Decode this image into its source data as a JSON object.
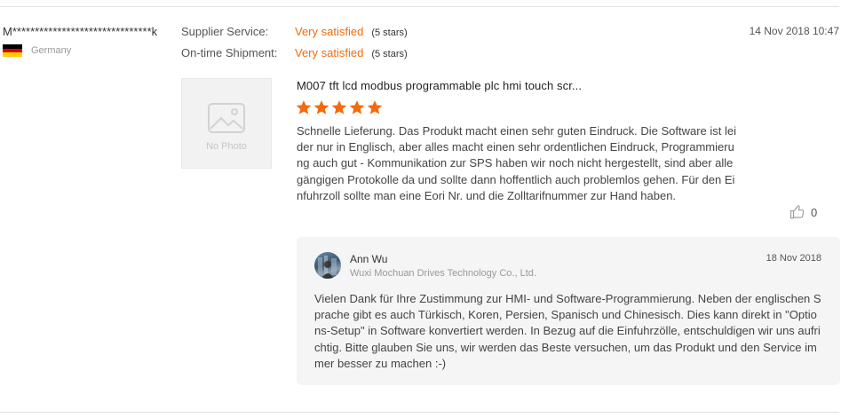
{
  "buyer": {
    "name": "M*******************************k",
    "country": "Germany",
    "flag_colors": [
      "#000000",
      "#dd0000",
      "#ffce00"
    ]
  },
  "ratings": [
    {
      "label": "Supplier Service:",
      "value": "Very satisfied",
      "stars": "(5 stars)"
    },
    {
      "label": "On-time Shipment:",
      "value": "Very satisfied",
      "stars": "(5 stars)"
    }
  ],
  "review": {
    "date": "14 Nov 2018 10:47",
    "no_photo_label": "No Photo",
    "product_title": "M007 tft lcd modbus programmable plc hmi touch scr...",
    "star_rating": 5,
    "text": "Schnelle Lieferung. Das Produkt macht einen sehr guten Eindruck. Die Software ist leider nur in Englisch, aber alles macht einen sehr ordentlichen Eindruck,  Programmierung auch gut - Kommunikation zur SPS haben wir noch nicht hergestellt, sind aber alle gängigen Protokolle da und sollte dann hoffentlich auch problemlos gehen. Für den Einfuhrzoll sollte man eine Eori Nr. und die Zolltarifnummer zur Hand haben.",
    "likes": "0"
  },
  "reply": {
    "name": "Ann Wu",
    "company": "Wuxi Mochuan Drives Technology Co., Ltd.",
    "date": "18 Nov 2018",
    "text": "Vielen Dank für Ihre Zustimmung zur HMI- und Software-Programmierung. Neben der englischen Sprache gibt es auch Türkisch, Koren, Persien, Spanisch und Chinesisch. Dies kann direkt in \"Options-Setup\" in Software konvertiert werden. In Bezug auf die Einfuhrzölle, entschuldigen wir uns aufrichtig. Bitte glauben Sie uns, wir werden das Beste versuchen, um das Produkt und den Service immer besser zu machen :-)"
  },
  "colors": {
    "accent": "#f36b0c",
    "star": "#f36b0c",
    "reply_bg": "#f5f5f5"
  }
}
